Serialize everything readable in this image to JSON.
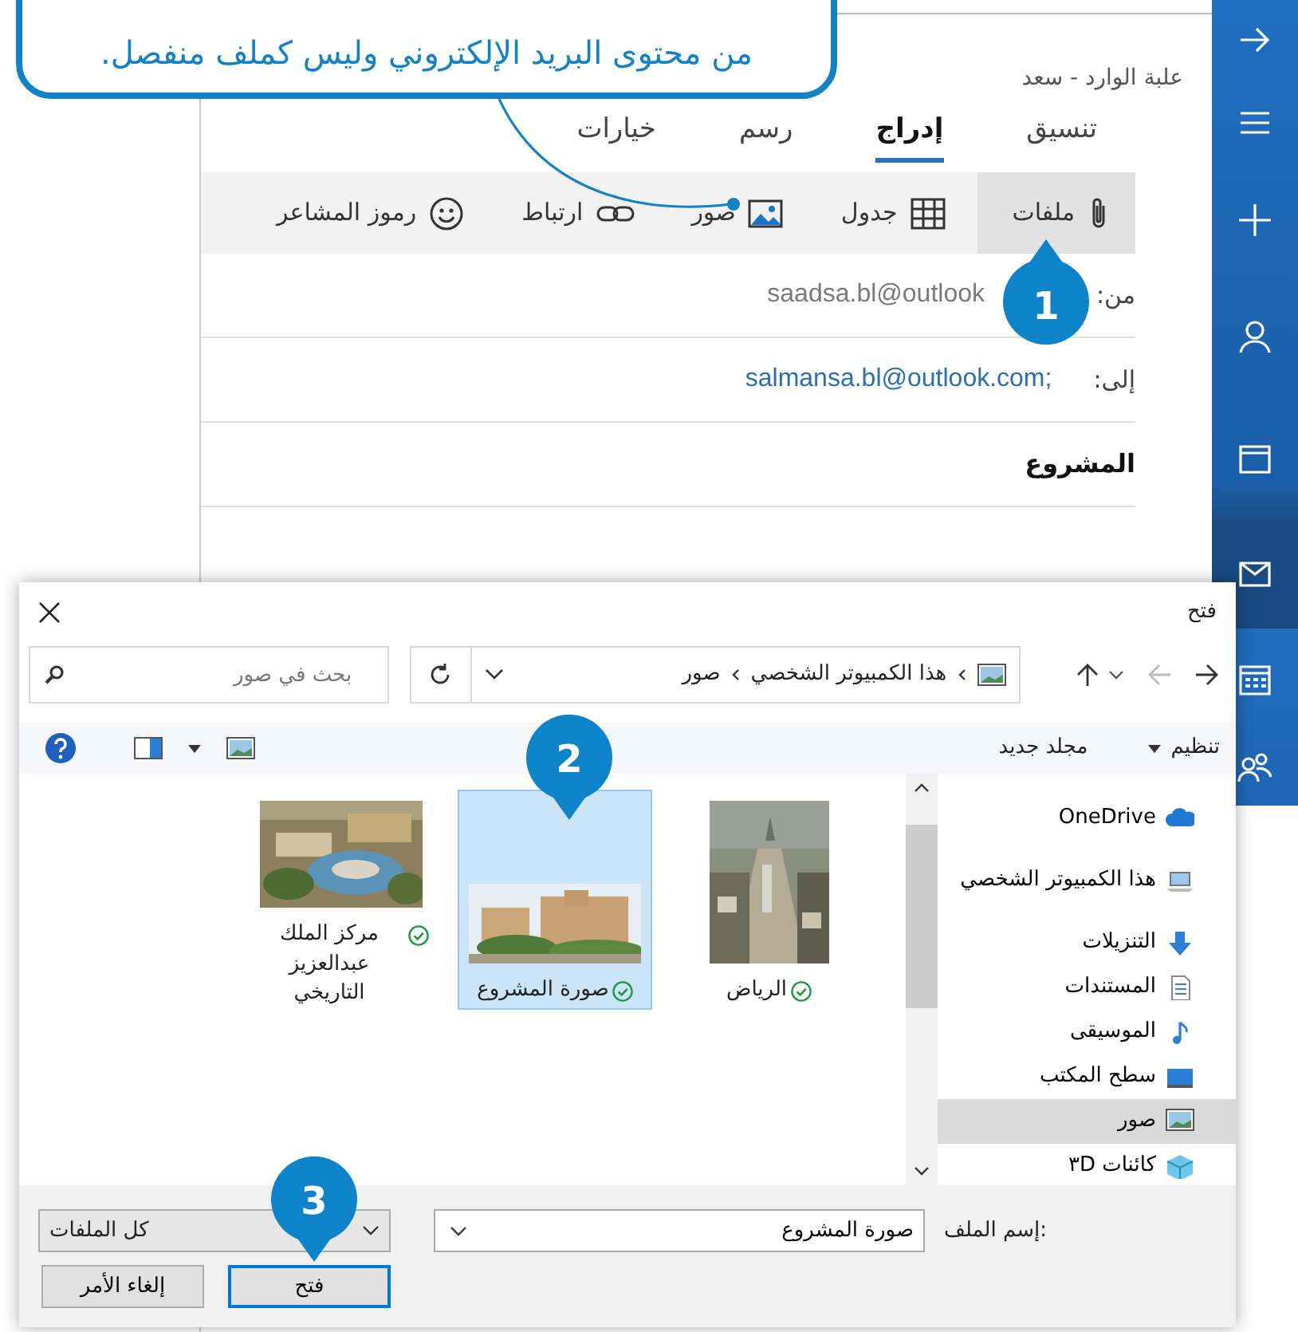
{
  "callout": {
    "text": "من محتوى البريد الإلكتروني وليس كملف منفصل."
  },
  "mail": {
    "header": "علبة الوارد - سعد",
    "tabs": [
      {
        "label": "تنسيق",
        "selected": false
      },
      {
        "label": "إدراج",
        "selected": true
      },
      {
        "label": "رسم",
        "selected": false
      },
      {
        "label": "خيارات",
        "selected": false
      }
    ],
    "toolbar": [
      {
        "label": "ملفات",
        "selected": true
      },
      {
        "label": "جدول",
        "selected": false
      },
      {
        "label": "صور",
        "selected": false
      },
      {
        "label": "ارتباط",
        "selected": false
      },
      {
        "label": "رموز المشاعر",
        "selected": false
      }
    ],
    "fields": [
      {
        "label": "من:",
        "value": "saadsa.bl@outlook",
        "kind": "from"
      },
      {
        "label": "إلى:",
        "value": "salmansa.bl@outlook.com;",
        "kind": "to"
      }
    ],
    "subject": "المشروع"
  },
  "sidebar": {
    "items": [
      {
        "selected": false
      },
      {
        "selected": false
      },
      {
        "selected": false
      },
      {
        "selected": false
      },
      {
        "selected": false
      },
      {
        "selected": true
      },
      {
        "selected": false
      },
      {
        "selected": false
      }
    ]
  },
  "dialog": {
    "title": "فتح",
    "path": [
      "هذا الكمبيوتر الشخصي",
      "صور"
    ],
    "search": {
      "placeholder": "بحث في صور"
    },
    "commands": [
      "تنظيم",
      "مجلد جديد"
    ],
    "nav": [
      {
        "label": "OneDrive",
        "selected": false
      },
      {
        "label": "هذا الكمبيوتر الشخصي",
        "selected": false
      },
      {
        "label": "التنزيلات",
        "selected": false
      },
      {
        "label": "المستندات",
        "selected": false
      },
      {
        "label": "الموسيقى",
        "selected": false
      },
      {
        "label": "سطح المكتب",
        "selected": false
      },
      {
        "label": "صور",
        "selected": true
      },
      {
        "label": "كائنات ٣D",
        "selected": false
      }
    ],
    "files": [
      {
        "name": "الرياض",
        "selected": false
      },
      {
        "name": "صورة المشروع",
        "selected": true
      },
      {
        "name": "مركز الملك عبدالعزيز التاريخي",
        "selected": false
      }
    ],
    "filename": {
      "label": "إسم الملف:",
      "value": "صورة المشروع"
    },
    "filter": "كل الملفات",
    "buttons": [
      {
        "label": "فتح",
        "kind": "default"
      },
      {
        "label": "إلغاء الأمر",
        "kind": "normal"
      }
    ]
  },
  "steps": [
    "1",
    "2",
    "3"
  ]
}
